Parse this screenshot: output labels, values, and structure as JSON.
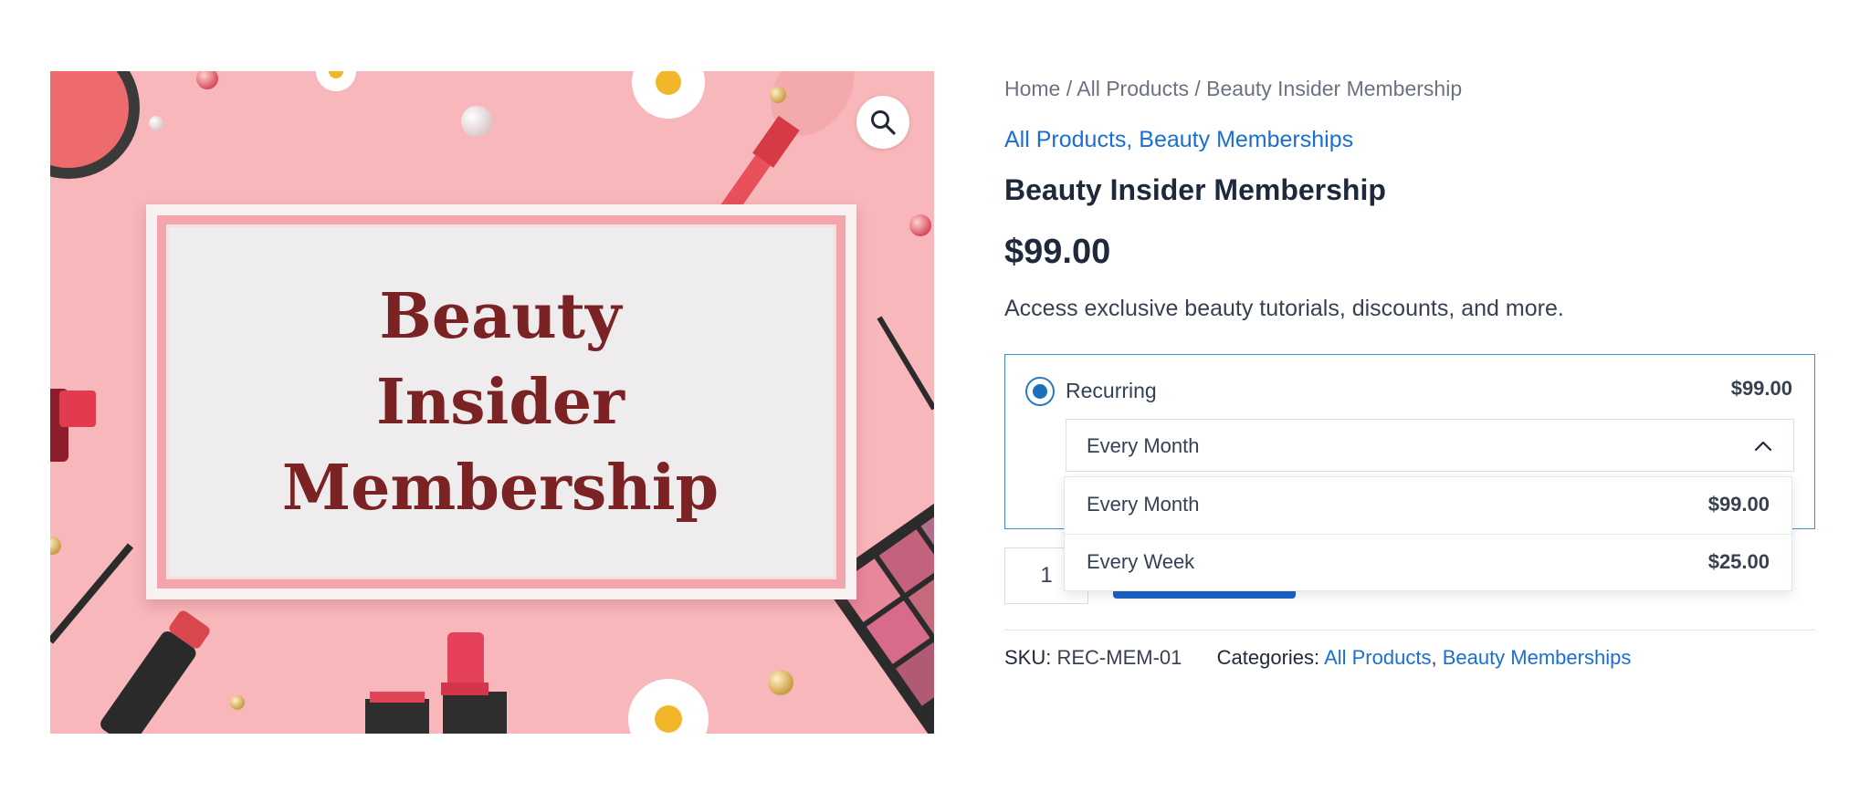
{
  "gallery": {
    "image_text": [
      "Beauty",
      "Insider",
      "Membership"
    ],
    "zoom_icon": "magnifier-icon"
  },
  "breadcrumb": {
    "items": [
      "Home",
      "All Products",
      "Beauty Insider Membership"
    ],
    "separator": "/"
  },
  "categories_top": [
    "All Products",
    "Beauty Memberships"
  ],
  "product": {
    "title": "Beauty Insider Membership",
    "price": "$99.00",
    "short_description": "Access exclusive beauty tutorials, discounts, and more."
  },
  "plan": {
    "label": "Recurring",
    "price": "$99.00",
    "selected": true,
    "interval_select": {
      "value": "Every Month",
      "icon": "chevron-up-icon",
      "options": [
        {
          "label": "Every Month",
          "price": "$99.00"
        },
        {
          "label": "Every Week",
          "price": "$25.00"
        }
      ]
    }
  },
  "cart": {
    "quantity": "1"
  },
  "meta": {
    "sku_label": "SKU:",
    "sku_value": "REC-MEM-01",
    "categories_label": "Categories:",
    "categories": [
      "All Products",
      "Beauty Memberships"
    ]
  },
  "colors": {
    "link": "#1a6fd1",
    "accent_button": "#1a63c9",
    "plan_border": "#3b8fc4",
    "image_background": "#f8b7ba",
    "image_title": "#7a2224"
  }
}
